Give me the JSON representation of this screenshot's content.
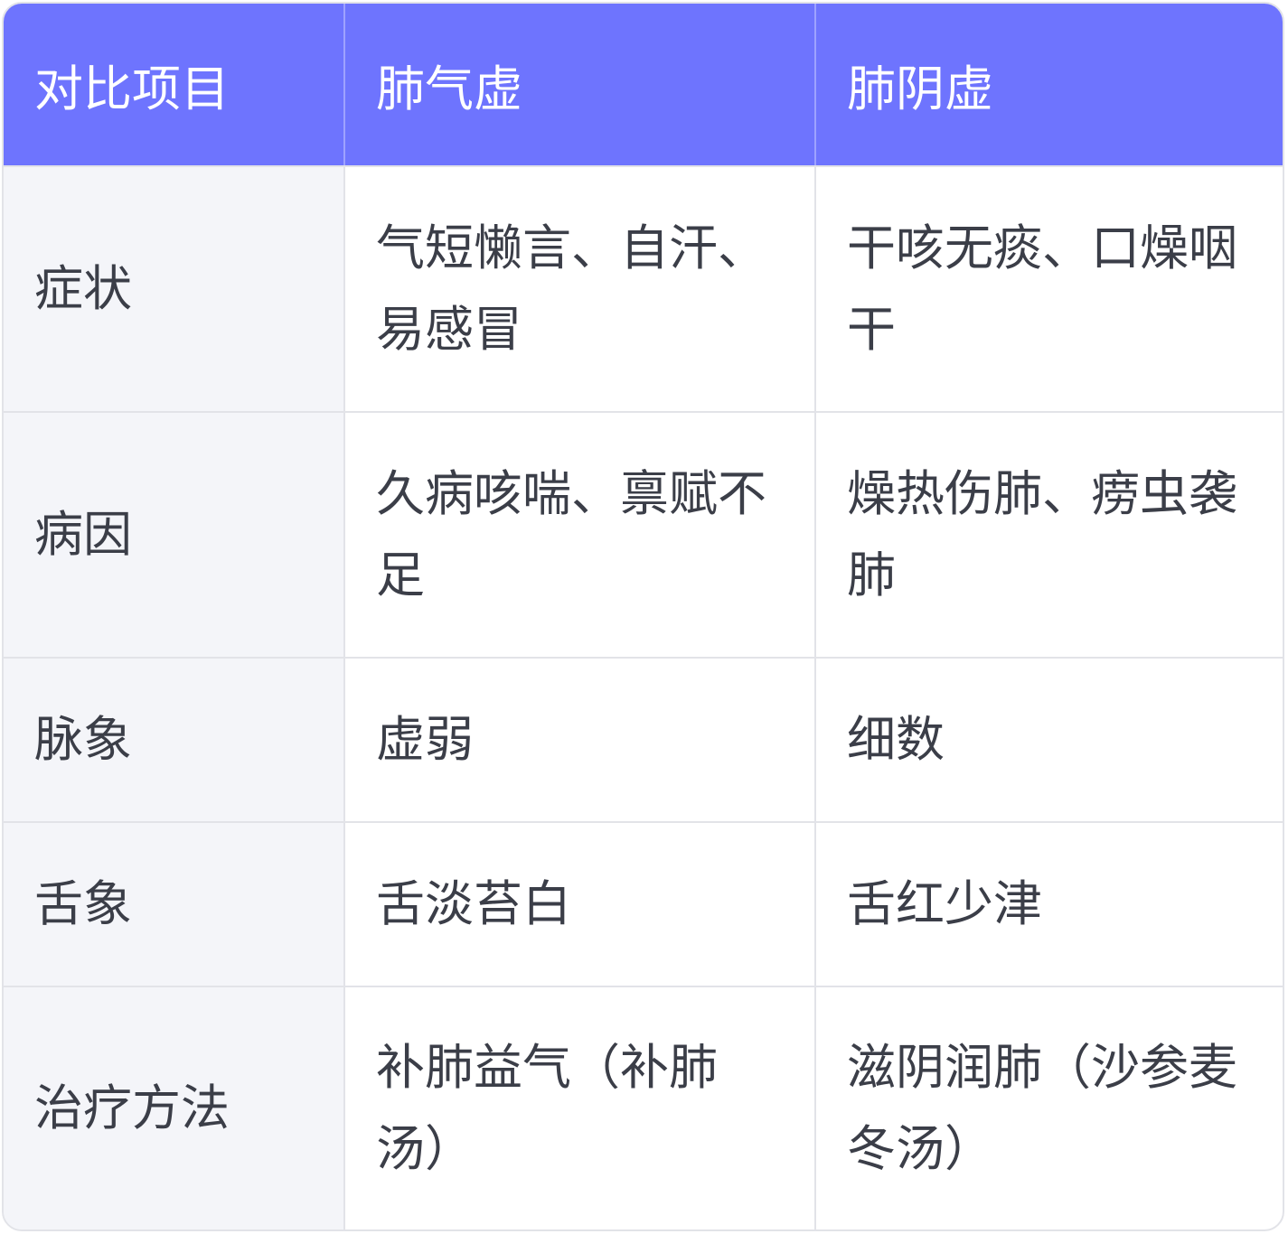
{
  "table": {
    "headers": [
      "对比项目",
      "肺气虚",
      "肺阴虚"
    ],
    "rows": [
      {
        "label": "症状",
        "qi": "气短懒言、自汗、易感冒",
        "yin": "干咳无痰、口燥咽干"
      },
      {
        "label": "病因",
        "qi": "久病咳喘、禀赋不足",
        "yin": "燥热伤肺、痨虫袭肺"
      },
      {
        "label": "脉象",
        "qi": "虚弱",
        "yin": "细数"
      },
      {
        "label": "舌象",
        "qi": "舌淡苔白",
        "yin": "舌红少津"
      },
      {
        "label": "治疗方法",
        "qi": "补肺益气（补肺汤）",
        "yin": "滋阴润肺（沙参麦冬汤）"
      }
    ]
  },
  "colors": {
    "header_bg": "#6e74fe",
    "header_text": "#ffffff",
    "label_bg": "#f4f5f9",
    "body_text": "#3b3e48",
    "border": "#e2e3e8"
  }
}
